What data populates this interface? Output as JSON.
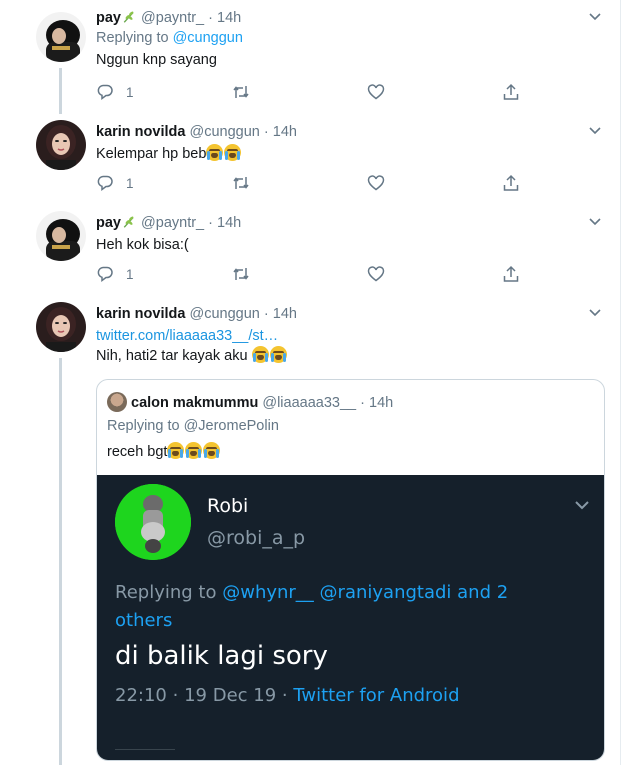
{
  "tweets": [
    {
      "name": "pay",
      "handle": "@payntr_",
      "time": "14h",
      "replying_prefix": "Replying to",
      "replying_to": "@cunggun",
      "text": "Nggun knp sayang",
      "reply_count": "1"
    },
    {
      "name": "karin novilda",
      "handle": "@cunggun",
      "time": "14h",
      "text": "Kelempar hp beb",
      "reply_count": "1"
    },
    {
      "name": "pay",
      "handle": "@payntr_",
      "time": "14h",
      "text": "Heh kok bisa:(",
      "reply_count": "1"
    },
    {
      "name": "karin novilda",
      "handle": "@cunggun",
      "time": "14h",
      "link": "twitter.com/liaaaaa33__/st…",
      "text": "Nih, hati2 tar kayak aku "
    }
  ],
  "quoted": {
    "name": "calon makmummu",
    "handle": "@liaaaaa33__",
    "time": "14h",
    "replying": "Replying to @JeromePolin",
    "text": "receh bgt"
  },
  "screenshot": {
    "name": "Robi",
    "handle": "@robi_a_p",
    "replying_prefix": "Replying to",
    "mention_1": "@whynr__",
    "mention_2": "@raniyangtadi",
    "and_more": "and 2 others",
    "text": "di balik lagi sory",
    "time": "22:10",
    "date": "19 Dec 19",
    "client": "Twitter for Android"
  },
  "separator": "·",
  "icons": {
    "reply": "reply-icon",
    "retweet": "retweet-icon",
    "like": "heart-icon",
    "share": "share-icon",
    "more": "chevron-down-icon",
    "emoji_leaf": "herb-emoji",
    "emoji_cry": "loudly-crying-face-emoji"
  },
  "colors": {
    "link": "#1da1f2",
    "muted": "#657786",
    "thread_line": "#ccd6dd",
    "dark_bg": "#15202b",
    "green_avatar": "#1ed51e"
  }
}
